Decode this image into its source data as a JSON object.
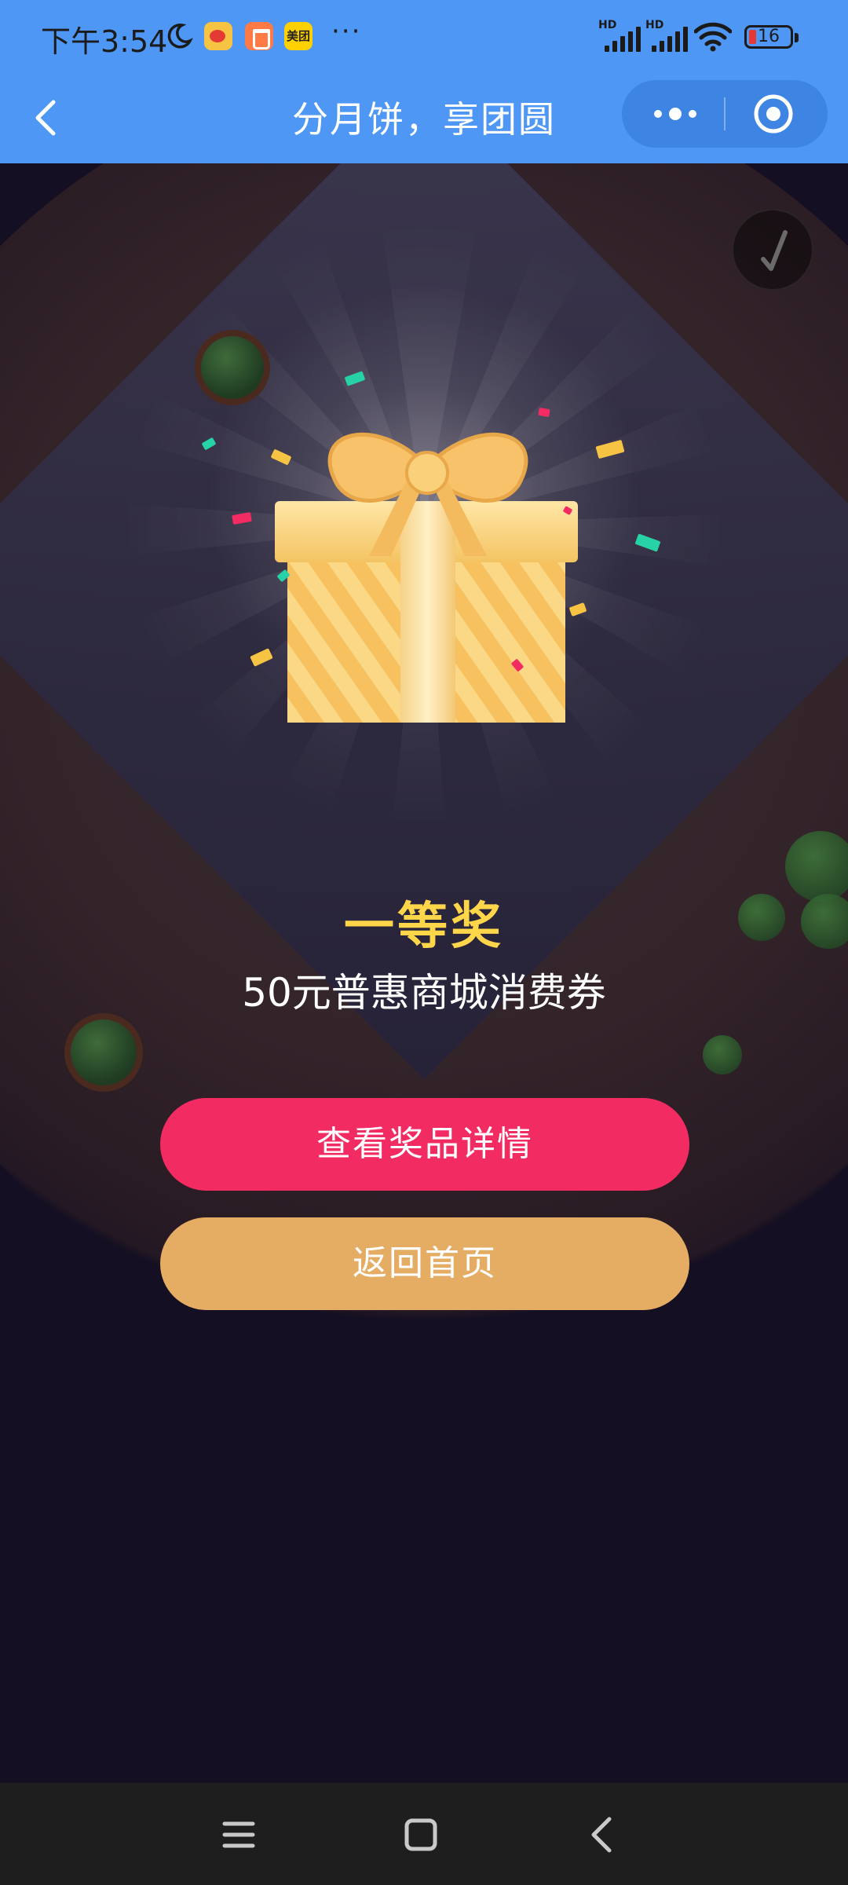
{
  "status_bar": {
    "time": "下午3:54",
    "app_icons": [
      "moon-icon",
      "weibo-icon",
      "shopping-icon",
      "meituan-icon"
    ],
    "meituan_label": "美团",
    "more": "···",
    "signal_1": "HD",
    "signal_2": "HD",
    "battery": "16"
  },
  "title_bar": {
    "title": "分月饼，享团圆",
    "back_icon": "chevron-left-icon",
    "capsule_menu_icon": "more-dots-icon",
    "capsule_close_icon": "target-circle-icon"
  },
  "prize": {
    "level": "一等奖",
    "name": "50元普惠商城消费券"
  },
  "buttons": {
    "view_details": "查看奖品详情",
    "back_home": "返回首页"
  },
  "colors": {
    "header": "#4f97f5",
    "primary_button": "#f32b63",
    "secondary_button": "#e5ac64",
    "prize_level": "#ffd64a",
    "background": "#140f22"
  },
  "navbar": {
    "icons": [
      "menu-icon",
      "home-square-icon",
      "back-icon"
    ]
  }
}
